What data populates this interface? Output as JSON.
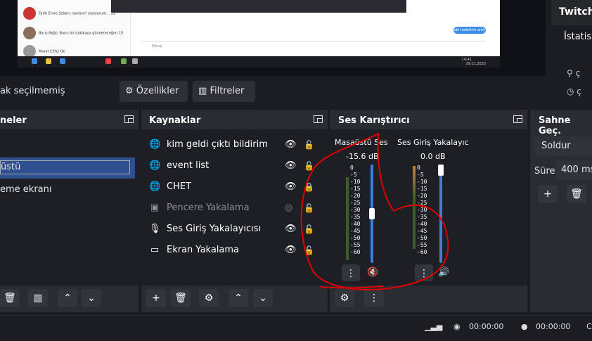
{
  "preview": {
    "chats": [
      {
        "name": "Fatih Emre",
        "snippet": "Selam, nasılsın? yazıyorum...",
        "time": "11"
      },
      {
        "name": "Barış Bağcı",
        "snippet": "Bunu bir dakikaya göndereceğim",
        "time": "15"
      },
      {
        "name": "Murat Çiftçi",
        "snippet": "Ok",
        "time": ""
      }
    ],
    "bubble_text": "abi hallettim artık",
    "msg_placeholder": "Mesaj",
    "clock": "14:41",
    "date": "29.11.2023"
  },
  "twitch": {
    "title": "Twitch",
    "stats": "İstatis",
    "icons": [
      "person-icon",
      "clock-icon"
    ]
  },
  "source_bar": {
    "no_source": "ak seçilmemiş",
    "properties": "Özellikler",
    "filters": "Filtreler"
  },
  "scenes": {
    "title": "neler",
    "items": [
      "üstü",
      "eme ekranı"
    ]
  },
  "sources": {
    "title": "Kaynaklar",
    "items": [
      {
        "label": "kim geldi çıktı  bildirim",
        "icon": "globe-icon",
        "visible": true,
        "locked": false
      },
      {
        "label": "event list",
        "icon": "globe-icon",
        "visible": true,
        "locked": false
      },
      {
        "label": "CHET",
        "icon": "globe-icon",
        "visible": true,
        "locked": true
      },
      {
        "label": "Pencere Yakalama",
        "icon": "window-icon",
        "visible": false,
        "locked": false
      },
      {
        "label": "Ses Giriş Yakalayıcısı",
        "icon": "mic-icon",
        "visible": true,
        "locked": false
      },
      {
        "label": "Ekran Yakalama",
        "icon": "monitor-icon",
        "visible": true,
        "locked": false
      }
    ]
  },
  "mixer": {
    "title": "Ses Karıştırıcı",
    "channels": [
      {
        "name": "Masaüstü Ses",
        "db": "-15.6 dB",
        "level": 0.5,
        "muted": true
      },
      {
        "name": "Ses Giriş Yakalayıc",
        "db": "0.0 dB",
        "level": 1.0,
        "muted": false
      }
    ],
    "scale": [
      "0",
      "-5",
      "-10",
      "-15",
      "-20",
      "-25",
      "-30",
      "-35",
      "-40",
      "-45",
      "-50",
      "-55",
      "-60"
    ]
  },
  "transitions": {
    "title": "Sahne Geç.",
    "type": "Soldur",
    "duration_label": "Süre",
    "duration_value": "400 ms"
  },
  "status": {
    "stream_time": "00:00:00",
    "rec_time": "00:00:00",
    "cpu": "C"
  },
  "colors": {
    "accent": "#3b7fd6",
    "selected_scene": "#2f4f8f",
    "annotation": "#e00000",
    "muted": "#d63b3b"
  }
}
